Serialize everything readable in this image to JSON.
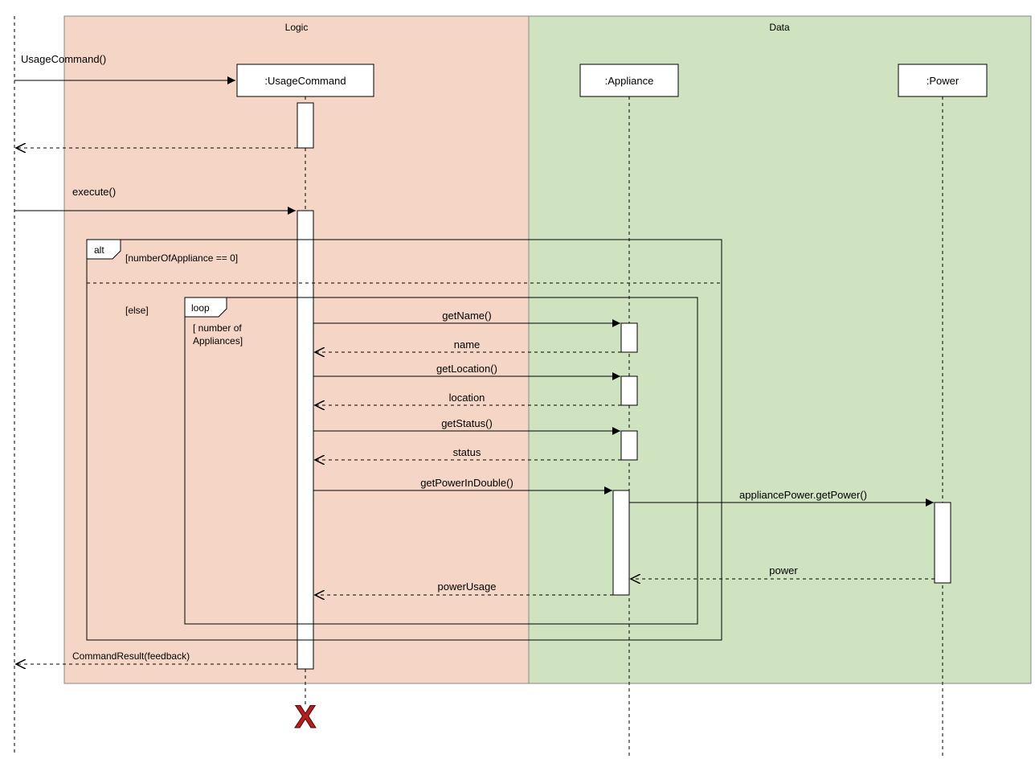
{
  "regions": {
    "logic_label": "Logic",
    "data_label": "Data"
  },
  "lifelines": {
    "usage_command": ":UsageCommand",
    "appliance": ":Appliance",
    "power": ":Power"
  },
  "frames": {
    "alt_label": "alt",
    "alt_guard1": "[numberOfAppliance == 0]",
    "alt_guard2": "[else]",
    "loop_label": "loop",
    "loop_guard_l1": "[ number of",
    "loop_guard_l2": "Appliances]"
  },
  "messages": {
    "m_ctor": "UsageCommand()",
    "m_execute": "execute()",
    "m_getName": "getName()",
    "r_name": "name",
    "m_getLocation": "getLocation()",
    "r_location": "location",
    "m_getStatus": "getStatus()",
    "r_status": "status",
    "m_getPowerInDouble": "getPowerInDouble()",
    "m_getPower": "appliancePower.getPower()",
    "r_power": "power",
    "r_powerUsage": "powerUsage",
    "r_result": "CommandResult(feedback)"
  },
  "destroy_glyph": "X"
}
